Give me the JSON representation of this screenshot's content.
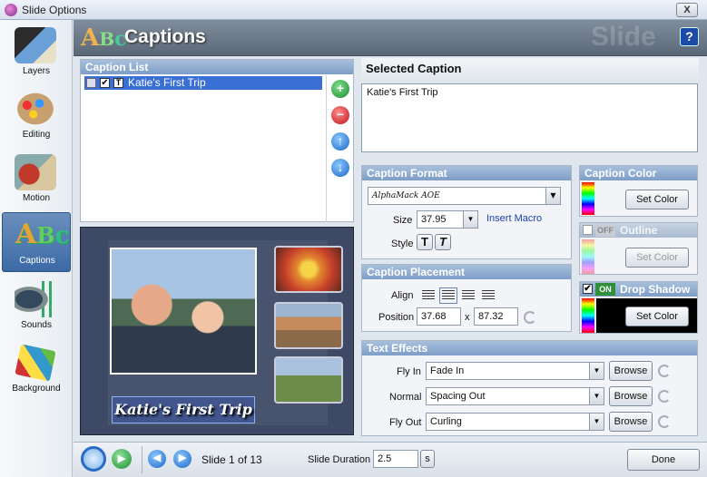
{
  "window": {
    "title": "Slide Options",
    "close": "X"
  },
  "sidebar": {
    "items": [
      {
        "label": "Layers",
        "icon": "film-stack-icon"
      },
      {
        "label": "Editing",
        "icon": "palette-icon"
      },
      {
        "label": "Motion",
        "icon": "motion-clock-icon"
      },
      {
        "label": "Captions",
        "icon": "abc-captions-icon"
      },
      {
        "label": "Sounds",
        "icon": "speaker-icon"
      },
      {
        "label": "Background",
        "icon": "paint-bucket-icon"
      }
    ]
  },
  "header": {
    "title": "Captions",
    "watermark": "Slide",
    "help": "?"
  },
  "caption_list": {
    "title": "Caption List",
    "items": [
      {
        "label": "Katie's First Trip",
        "checked": true
      }
    ]
  },
  "preview": {
    "caption_text": "Katie's First Trip"
  },
  "selected_caption": {
    "title": "Selected Caption",
    "text": "Katie's First Trip"
  },
  "caption_format": {
    "title": "Caption Format",
    "font": "AlphaMack AOE",
    "size_label": "Size",
    "size": "37.95",
    "insert_macro": "Insert Macro",
    "style_label": "Style",
    "bold": "T",
    "italic": "T"
  },
  "caption_placement": {
    "title": "Caption Placement",
    "align_label": "Align",
    "position_label": "Position",
    "x": "37.68",
    "sep": "x",
    "y": "87.32"
  },
  "caption_color": {
    "title": "Caption Color",
    "button": "Set Color"
  },
  "outline": {
    "title": "Outline",
    "state": "OFF",
    "button": "Set Color"
  },
  "drop_shadow": {
    "title": "Drop Shadow",
    "state": "ON",
    "button": "Set Color"
  },
  "text_effects": {
    "title": "Text Effects",
    "rows": [
      {
        "label": "Fly In",
        "value": "Fade In",
        "button": "Browse"
      },
      {
        "label": "Normal",
        "value": "Spacing Out",
        "button": "Browse"
      },
      {
        "label": "Fly Out",
        "value": "Curling",
        "button": "Browse"
      }
    ]
  },
  "bottom": {
    "slide_info": "Slide 1 of 13",
    "duration_label": "Slide Duration",
    "duration": "2.5",
    "unit": "s",
    "done": "Done"
  },
  "colors": {
    "accent": "#3a6fd6",
    "header": "#6b7888",
    "panel_head": "#8fadd2"
  }
}
